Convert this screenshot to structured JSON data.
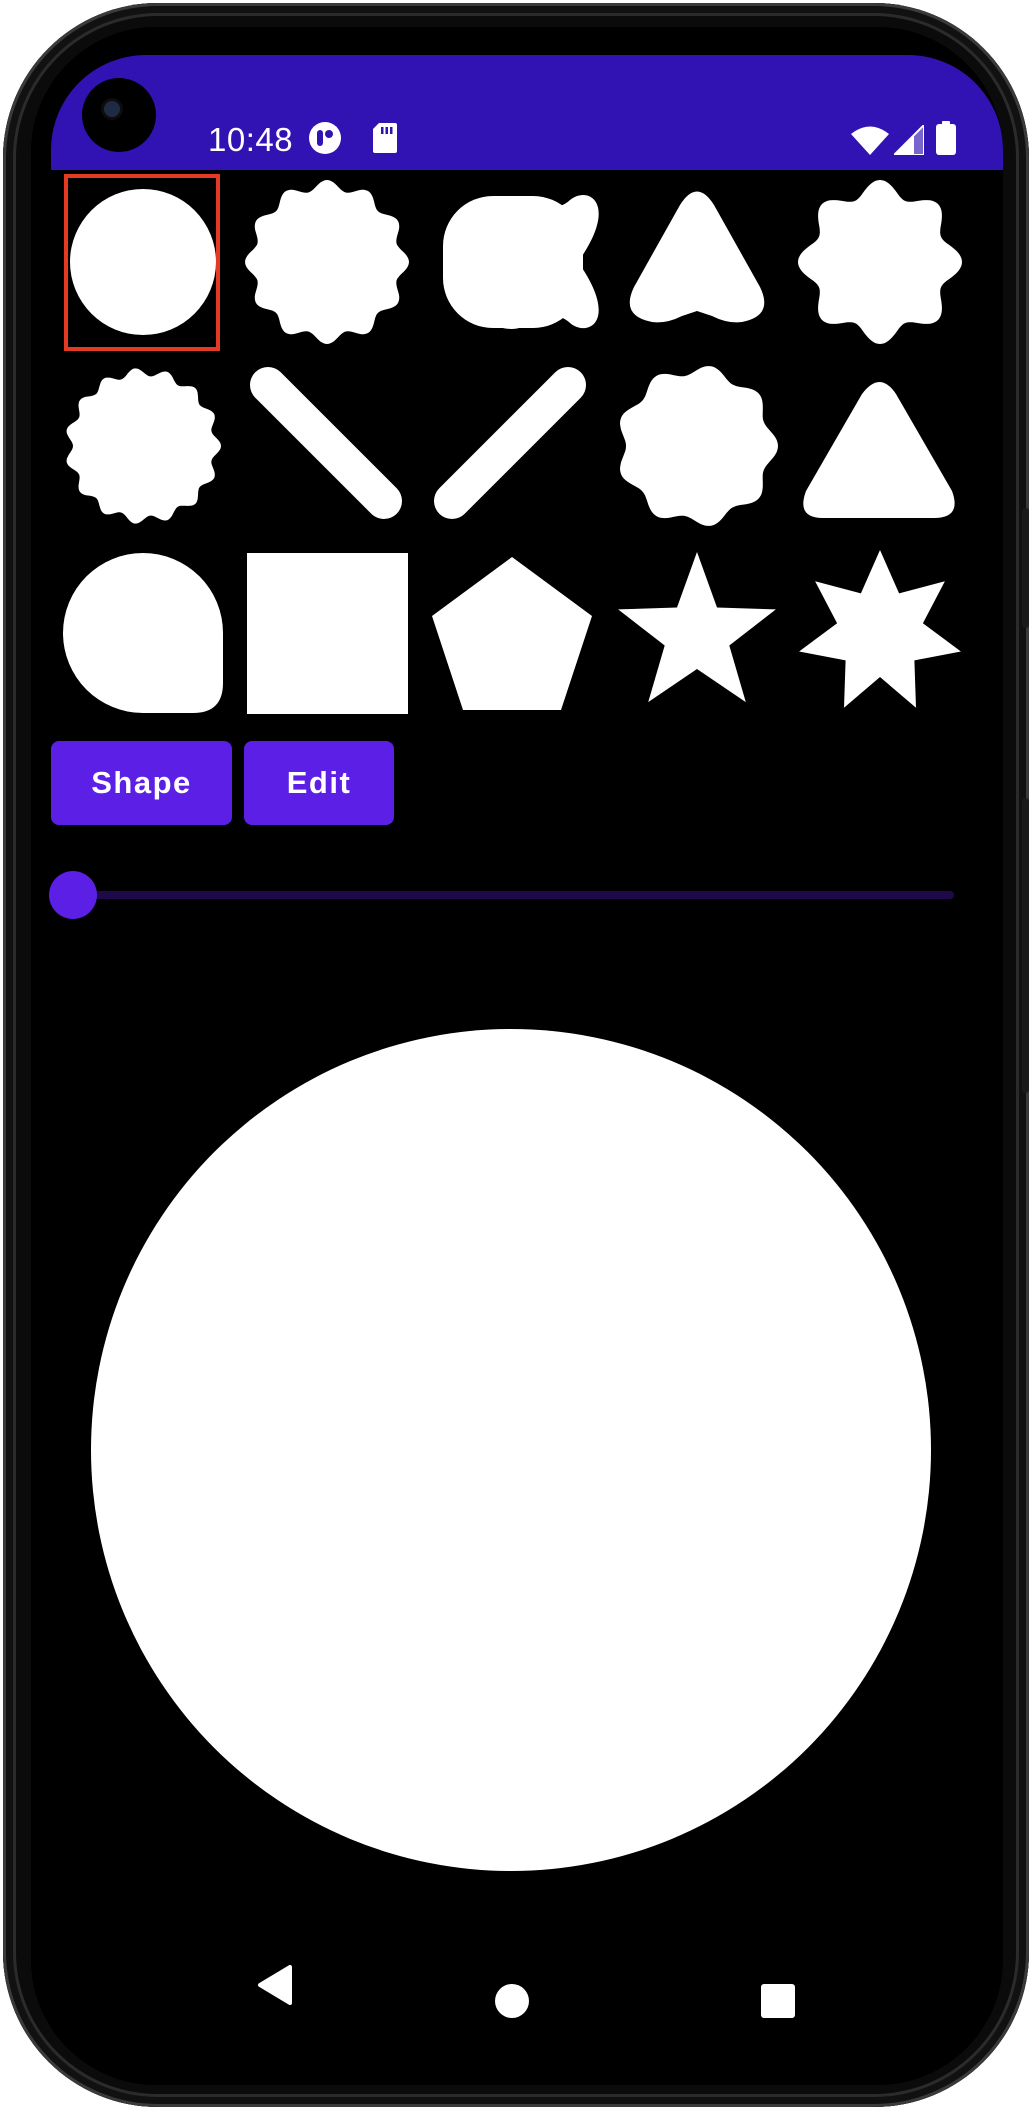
{
  "status_bar": {
    "time": "10:48",
    "icons": [
      "notification-app-icon",
      "sd-card-icon",
      "wifi-icon",
      "cell-signal-icon",
      "battery-icon"
    ]
  },
  "shape_grid": {
    "shapes": [
      "circle",
      "scalloped-12",
      "clover-4",
      "rounded-triangle",
      "wavy-star-8",
      "wavy-circle-15",
      "pill-diagonal-left",
      "pill-diagonal-right",
      "wavy-circle-9",
      "rounded-triangle-up",
      "tear-drop",
      "square",
      "pentagon",
      "star-5",
      "star-7"
    ],
    "selected_index": 0
  },
  "buttons": {
    "shape_label": "Shape",
    "edit_label": "Edit"
  },
  "slider": {
    "value": 0
  },
  "preview": {
    "shape": "circle"
  },
  "nav": {
    "icons": [
      "back-icon",
      "home-icon",
      "recents-icon"
    ]
  },
  "colors": {
    "accent": "#5b1fe6",
    "status_bar": "#3113b3",
    "selection": "#e33a24"
  }
}
